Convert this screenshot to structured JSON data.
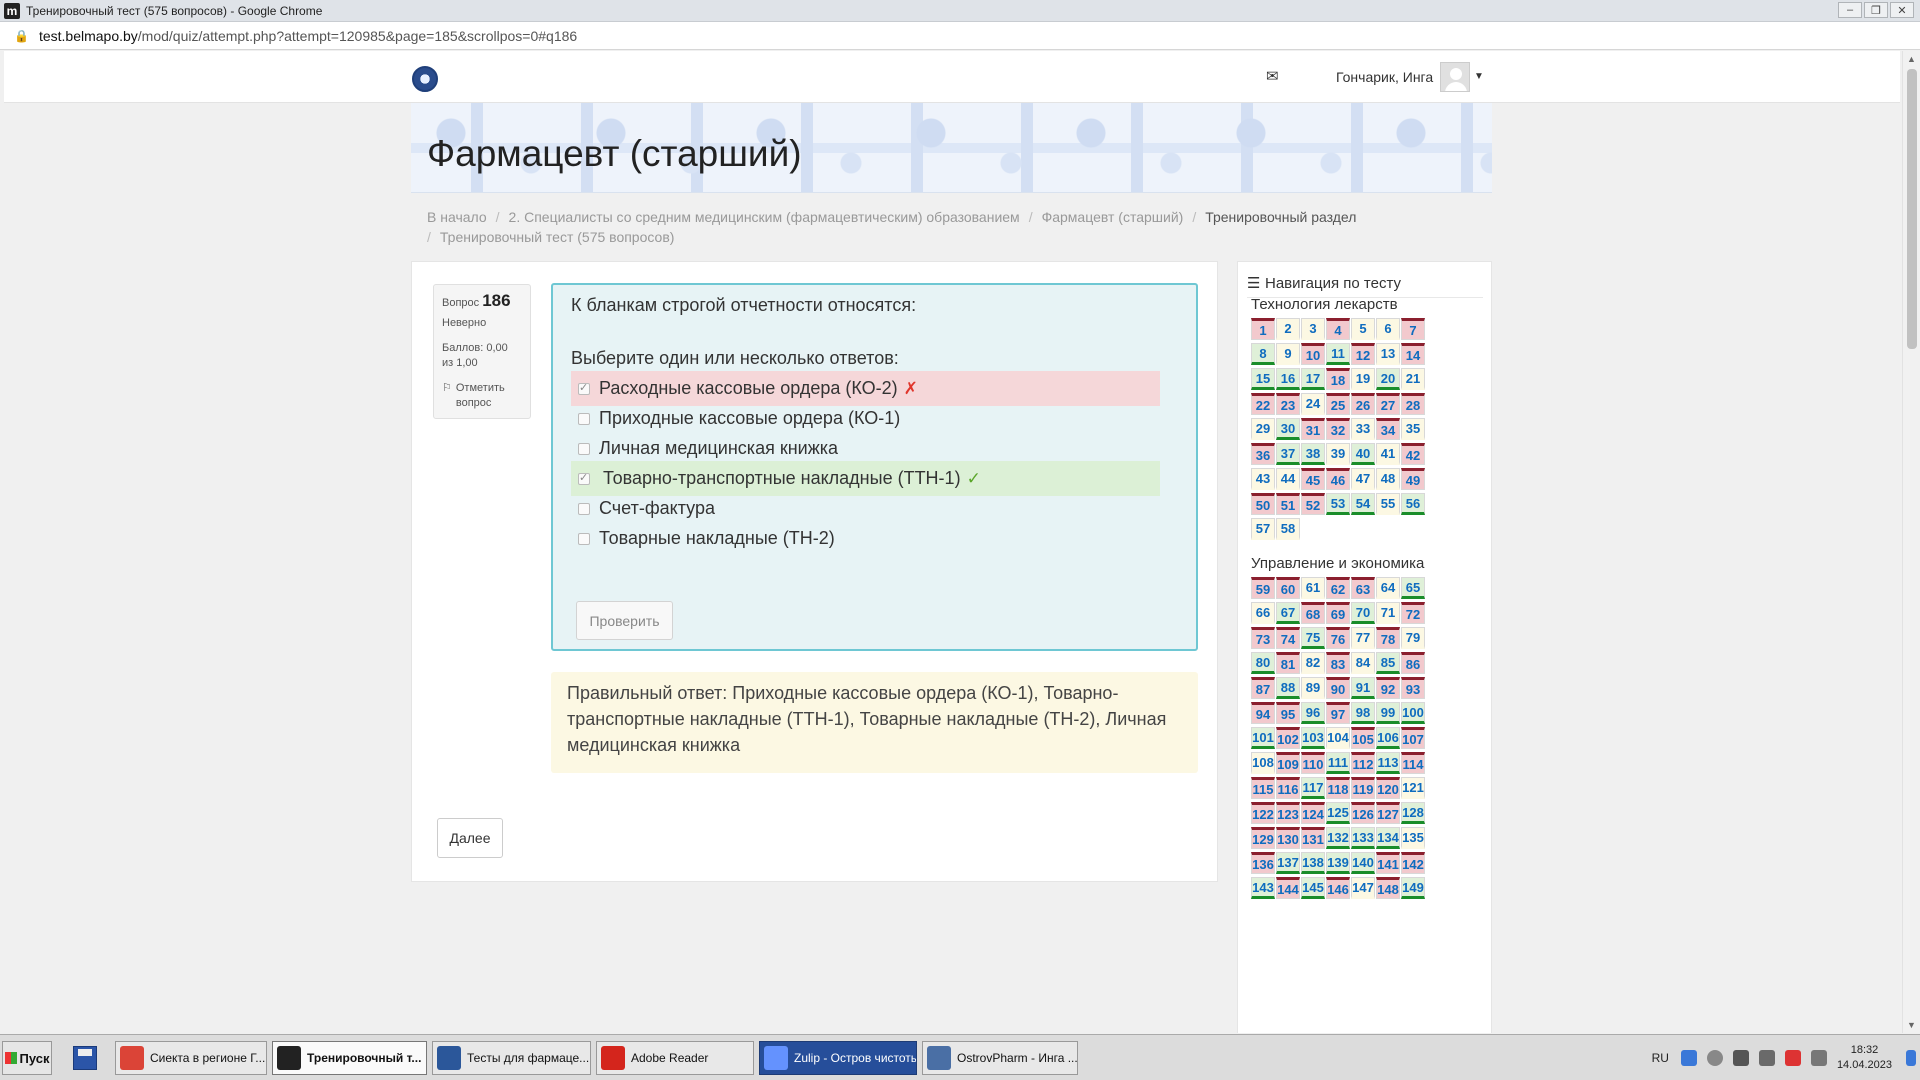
{
  "window": {
    "title": "Тренировочный тест (575 вопросов) - Google Chrome",
    "app_icon": "m"
  },
  "address": {
    "host": "test.belmapo.by",
    "path": "/mod/quiz/attempt.php?attempt=120985&page=185&scrollpos=0#q186"
  },
  "navbar": {
    "user_name": "Гончарик, Инга"
  },
  "course": {
    "title": "Фармацевт (старший)"
  },
  "breadcrumb": [
    "В начало",
    "2. Специалисты со средним медицинским (фармацевтическим) образованием",
    "Фармацевт (старший)",
    "Тренировочный раздел",
    "Тренировочный тест (575 вопросов)"
  ],
  "question_info": {
    "label": "Вопрос",
    "number": "186",
    "state": "Неверно",
    "grade": "Баллов: 0,00 из 1,00",
    "flag": "Отметить вопрос"
  },
  "question": {
    "text": "К бланкам строгой отчетности относятся:",
    "prompt": "Выберите один или несколько ответов:",
    "answers": [
      {
        "label": "Расходные кассовые ордера (КО-2)",
        "checked": true,
        "status": "incorrect"
      },
      {
        "label": "Приходные кассовые ордера (КО-1)",
        "checked": false,
        "status": "none"
      },
      {
        "label": "Личная медицинская книжка",
        "checked": false,
        "status": "none"
      },
      {
        "label": "Товарно-транспортные накладные (ТТН-1)",
        "checked": true,
        "status": "correct"
      },
      {
        "label": "Счет-фактура",
        "checked": false,
        "status": "none"
      },
      {
        "label": "Товарные накладные (ТН-2)",
        "checked": false,
        "status": "none"
      }
    ],
    "check_label": "Проверить"
  },
  "outcome": {
    "text": "Правильный ответ: Приходные кассовые ордера (КО-1),  Товарно-транспортные накладные (ТТН-1), Товарные накладные (ТН-2), Личная медицинская книжка"
  },
  "next_label": "Далее",
  "quiz_nav": {
    "title": "Навигация по тесту",
    "sections": [
      {
        "name": "Технология лекарств",
        "questions": [
          {
            "n": "1",
            "s": "wrong"
          },
          {
            "n": "2",
            "s": "notyet"
          },
          {
            "n": "3",
            "s": "notyet"
          },
          {
            "n": "4",
            "s": "wrong"
          },
          {
            "n": "5",
            "s": "notyet"
          },
          {
            "n": "6",
            "s": "notyet"
          },
          {
            "n": "7",
            "s": "wrong"
          },
          {
            "n": "8",
            "s": "right"
          },
          {
            "n": "9",
            "s": "notyet"
          },
          {
            "n": "10",
            "s": "wrong"
          },
          {
            "n": "11",
            "s": "right"
          },
          {
            "n": "12",
            "s": "wrong"
          },
          {
            "n": "13",
            "s": "notyet"
          },
          {
            "n": "14",
            "s": "wrong"
          },
          {
            "n": "15",
            "s": "right"
          },
          {
            "n": "16",
            "s": "right"
          },
          {
            "n": "17",
            "s": "right"
          },
          {
            "n": "18",
            "s": "wrong"
          },
          {
            "n": "19",
            "s": "notyet"
          },
          {
            "n": "20",
            "s": "right"
          },
          {
            "n": "21",
            "s": "notyet"
          },
          {
            "n": "22",
            "s": "wrong"
          },
          {
            "n": "23",
            "s": "wrong"
          },
          {
            "n": "24",
            "s": "notyet"
          },
          {
            "n": "25",
            "s": "wrong"
          },
          {
            "n": "26",
            "s": "wrong"
          },
          {
            "n": "27",
            "s": "wrong"
          },
          {
            "n": "28",
            "s": "wrong"
          },
          {
            "n": "29",
            "s": "notyet"
          },
          {
            "n": "30",
            "s": "right"
          },
          {
            "n": "31",
            "s": "wrong"
          },
          {
            "n": "32",
            "s": "wrong"
          },
          {
            "n": "33",
            "s": "notyet"
          },
          {
            "n": "34",
            "s": "wrong"
          },
          {
            "n": "35",
            "s": "notyet"
          },
          {
            "n": "36",
            "s": "wrong"
          },
          {
            "n": "37",
            "s": "right"
          },
          {
            "n": "38",
            "s": "right"
          },
          {
            "n": "39",
            "s": "notyet"
          },
          {
            "n": "40",
            "s": "right"
          },
          {
            "n": "41",
            "s": "notyet"
          },
          {
            "n": "42",
            "s": "wrong"
          },
          {
            "n": "43",
            "s": "notyet"
          },
          {
            "n": "44",
            "s": "notyet"
          },
          {
            "n": "45",
            "s": "wrong"
          },
          {
            "n": "46",
            "s": "wrong"
          },
          {
            "n": "47",
            "s": "notyet"
          },
          {
            "n": "48",
            "s": "notyet"
          },
          {
            "n": "49",
            "s": "wrong"
          },
          {
            "n": "50",
            "s": "wrong"
          },
          {
            "n": "51",
            "s": "wrong"
          },
          {
            "n": "52",
            "s": "wrong"
          },
          {
            "n": "53",
            "s": "right"
          },
          {
            "n": "54",
            "s": "right"
          },
          {
            "n": "55",
            "s": "notyet"
          },
          {
            "n": "56",
            "s": "right"
          },
          {
            "n": "57",
            "s": "notyet"
          },
          {
            "n": "58",
            "s": "notyet"
          }
        ]
      },
      {
        "name": "Управление и экономика",
        "questions": [
          {
            "n": "59",
            "s": "wrong"
          },
          {
            "n": "60",
            "s": "wrong"
          },
          {
            "n": "61",
            "s": "notyet"
          },
          {
            "n": "62",
            "s": "wrong"
          },
          {
            "n": "63",
            "s": "wrong"
          },
          {
            "n": "64",
            "s": "notyet"
          },
          {
            "n": "65",
            "s": "right"
          },
          {
            "n": "66",
            "s": "notyet"
          },
          {
            "n": "67",
            "s": "right"
          },
          {
            "n": "68",
            "s": "wrong"
          },
          {
            "n": "69",
            "s": "wrong"
          },
          {
            "n": "70",
            "s": "right"
          },
          {
            "n": "71",
            "s": "notyet"
          },
          {
            "n": "72",
            "s": "wrong"
          },
          {
            "n": "73",
            "s": "wrong"
          },
          {
            "n": "74",
            "s": "wrong"
          },
          {
            "n": "75",
            "s": "right"
          },
          {
            "n": "76",
            "s": "wrong"
          },
          {
            "n": "77",
            "s": "notyet"
          },
          {
            "n": "78",
            "s": "wrong"
          },
          {
            "n": "79",
            "s": "notyet"
          },
          {
            "n": "80",
            "s": "right"
          },
          {
            "n": "81",
            "s": "wrong"
          },
          {
            "n": "82",
            "s": "notyet"
          },
          {
            "n": "83",
            "s": "wrong"
          },
          {
            "n": "84",
            "s": "notyet"
          },
          {
            "n": "85",
            "s": "right"
          },
          {
            "n": "86",
            "s": "wrong"
          },
          {
            "n": "87",
            "s": "wrong"
          },
          {
            "n": "88",
            "s": "right"
          },
          {
            "n": "89",
            "s": "notyet"
          },
          {
            "n": "90",
            "s": "wrong"
          },
          {
            "n": "91",
            "s": "right"
          },
          {
            "n": "92",
            "s": "wrong"
          },
          {
            "n": "93",
            "s": "wrong"
          },
          {
            "n": "94",
            "s": "wrong"
          },
          {
            "n": "95",
            "s": "wrong"
          },
          {
            "n": "96",
            "s": "right"
          },
          {
            "n": "97",
            "s": "wrong"
          },
          {
            "n": "98",
            "s": "right"
          },
          {
            "n": "99",
            "s": "right"
          },
          {
            "n": "100",
            "s": "right"
          },
          {
            "n": "101",
            "s": "right"
          },
          {
            "n": "102",
            "s": "wrong"
          },
          {
            "n": "103",
            "s": "right"
          },
          {
            "n": "104",
            "s": "notyet"
          },
          {
            "n": "105",
            "s": "wrong"
          },
          {
            "n": "106",
            "s": "right"
          },
          {
            "n": "107",
            "s": "wrong"
          },
          {
            "n": "108",
            "s": "notyet"
          },
          {
            "n": "109",
            "s": "wrong"
          },
          {
            "n": "110",
            "s": "wrong"
          },
          {
            "n": "111",
            "s": "right"
          },
          {
            "n": "112",
            "s": "wrong"
          },
          {
            "n": "113",
            "s": "right"
          },
          {
            "n": "114",
            "s": "wrong"
          },
          {
            "n": "115",
            "s": "wrong"
          },
          {
            "n": "116",
            "s": "wrong"
          },
          {
            "n": "117",
            "s": "right"
          },
          {
            "n": "118",
            "s": "wrong"
          },
          {
            "n": "119",
            "s": "wrong"
          },
          {
            "n": "120",
            "s": "wrong"
          },
          {
            "n": "121",
            "s": "notyet"
          },
          {
            "n": "122",
            "s": "wrong"
          },
          {
            "n": "123",
            "s": "wrong"
          },
          {
            "n": "124",
            "s": "wrong"
          },
          {
            "n": "125",
            "s": "right"
          },
          {
            "n": "126",
            "s": "wrong"
          },
          {
            "n": "127",
            "s": "wrong"
          },
          {
            "n": "128",
            "s": "right"
          },
          {
            "n": "129",
            "s": "wrong"
          },
          {
            "n": "130",
            "s": "wrong"
          },
          {
            "n": "131",
            "s": "wrong"
          },
          {
            "n": "132",
            "s": "right"
          },
          {
            "n": "133",
            "s": "right"
          },
          {
            "n": "134",
            "s": "right"
          },
          {
            "n": "135",
            "s": "notyet"
          },
          {
            "n": "136",
            "s": "wrong"
          },
          {
            "n": "137",
            "s": "right"
          },
          {
            "n": "138",
            "s": "right"
          },
          {
            "n": "139",
            "s": "right"
          },
          {
            "n": "140",
            "s": "right"
          },
          {
            "n": "141",
            "s": "wrong"
          },
          {
            "n": "142",
            "s": "wrong"
          },
          {
            "n": "143",
            "s": "right"
          },
          {
            "n": "144",
            "s": "wrong"
          },
          {
            "n": "145",
            "s": "right"
          },
          {
            "n": "146",
            "s": "wrong"
          },
          {
            "n": "147",
            "s": "notyet"
          },
          {
            "n": "148",
            "s": "wrong"
          },
          {
            "n": "149",
            "s": "right"
          }
        ]
      }
    ]
  },
  "taskbar": {
    "start_label": "Пуск",
    "tasks": [
      {
        "label": "Сиекта в регионе Г...",
        "icon": "chrome-icon",
        "color": "#db4437",
        "active": false,
        "dark": false
      },
      {
        "label": "Тренировочный т...",
        "icon": "moodle-icon",
        "color": "#222222",
        "active": true,
        "dark": false
      },
      {
        "label": "Тесты для фармаце...",
        "icon": "word-icon",
        "color": "#2b579a",
        "active": false,
        "dark": false
      },
      {
        "label": "Adobe Reader",
        "icon": "adobe-reader-icon",
        "color": "#d4251c",
        "active": false,
        "dark": false
      },
      {
        "label": "Zulip - Остров чистоты",
        "icon": "zulip-icon",
        "color": "#6492fe",
        "active": false,
        "dark": true
      },
      {
        "label": "OstrovPharm - Инга ...",
        "icon": "ostrovpharm-icon",
        "color": "#4a6fa5",
        "active": false,
        "dark": false
      }
    ],
    "tray": {
      "lang": "RU",
      "time": "18:32",
      "date": "14.04.2023"
    }
  }
}
